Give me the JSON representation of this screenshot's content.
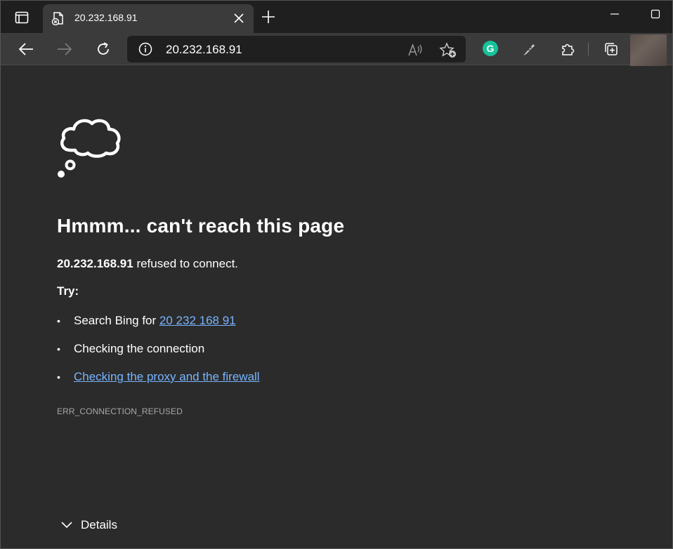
{
  "tab": {
    "title": "20.232.168.91"
  },
  "toolbar": {
    "url": "20.232.168.91",
    "grammarly_letter": "G"
  },
  "error_page": {
    "heading": "Hmmm... can't reach this page",
    "host": "20.232.168.91",
    "message_suffix": " refused to connect.",
    "try_label": "Try:",
    "suggestion_bing_prefix": "Search Bing for ",
    "suggestion_bing_link": "20 232 168 91",
    "suggestion_connection": "Checking the connection",
    "suggestion_proxy_link": "Checking the proxy and the firewall",
    "error_code": "ERR_CONNECTION_REFUSED",
    "details_label": "Details"
  },
  "colors": {
    "page_bg": "#2b2b2b",
    "tabstrip_bg": "#1f1f1f",
    "toolbar_bg": "#3b3b3b",
    "link": "#78b4ff",
    "grammarly": "#15c39a"
  }
}
